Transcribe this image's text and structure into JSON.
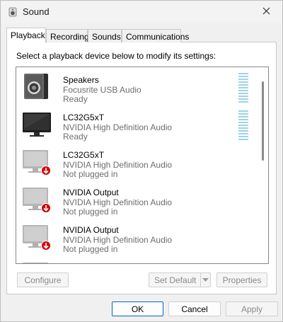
{
  "window": {
    "title": "Sound",
    "title_icon": "speaker-icon",
    "close_icon": "close-icon"
  },
  "tabs": [
    {
      "label": "Playback",
      "active": true
    },
    {
      "label": "Recording",
      "active": false
    },
    {
      "label": "Sounds",
      "active": false
    },
    {
      "label": "Communications",
      "active": false
    }
  ],
  "instruction": "Select a playback device below to modify its settings:",
  "devices": [
    {
      "name": "Speakers",
      "driver": "Focusrite USB Audio",
      "status": "Ready",
      "icon": "speaker-device-icon"
    },
    {
      "name": "LC32G5xT",
      "driver": "NVIDIA High Definition Audio",
      "status": "Ready",
      "icon": "monitor-icon"
    },
    {
      "name": "LC32G5xT",
      "driver": "NVIDIA High Definition Audio",
      "status": "Not plugged in",
      "icon": "monitor-disconnected-icon"
    },
    {
      "name": "NVIDIA Output",
      "driver": "NVIDIA High Definition Audio",
      "status": "Not plugged in",
      "icon": "monitor-disconnected-icon"
    },
    {
      "name": "NVIDIA Output",
      "driver": "NVIDIA High Definition Audio",
      "status": "Not plugged in",
      "icon": "monitor-disconnected-icon"
    }
  ],
  "buttons": {
    "configure": "Configure",
    "set_default": "Set Default",
    "properties": "Properties",
    "ok": "OK",
    "cancel": "Cancel",
    "apply": "Apply"
  },
  "colors": {
    "accent": "#0067c0",
    "meter": "#9fd3e4",
    "disconnected_badge": "#d50000"
  }
}
